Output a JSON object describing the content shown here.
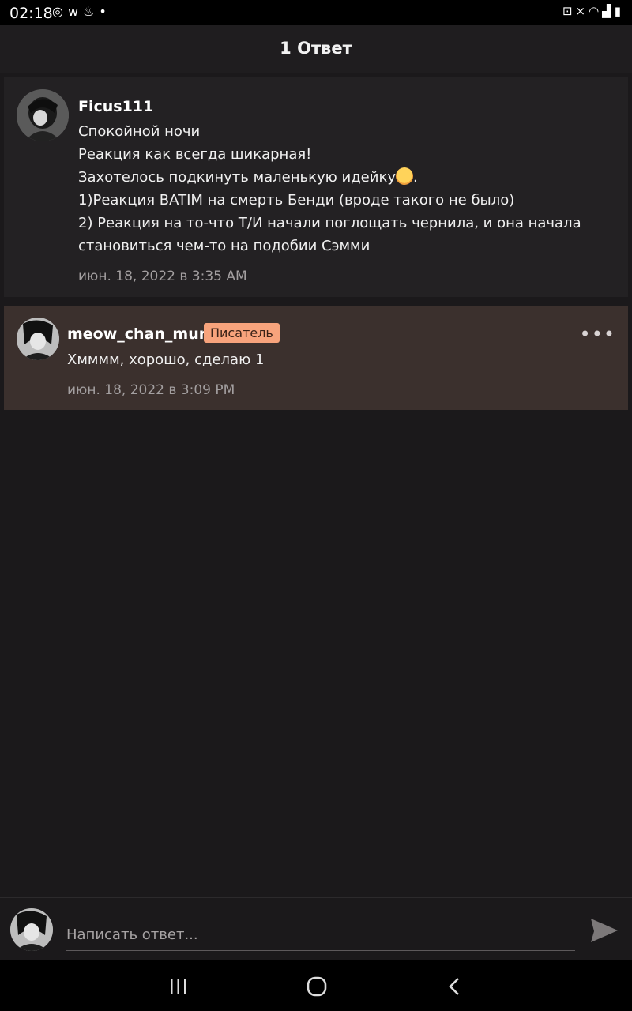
{
  "status_bar": {
    "time": "02:18",
    "left_icons": [
      "sync-icon",
      "w-app-icon",
      "flame-icon",
      "dot-icon"
    ],
    "right_icons": [
      "lock-icon",
      "mute-icon",
      "wifi-icon",
      "signal-icon",
      "battery-icon"
    ]
  },
  "header": {
    "title": "1 Ответ"
  },
  "parent_comment": {
    "username": "Ficus111",
    "lines": [
      "Спокойной ночи",
      "Реакция как всегда шикарная!",
      "Захотелось подкинуть маленькую идейку",
      "1)Реакция BATIM на смерть Бенди (вроде такого не было)",
      "2) Реакция на то-что Т/И начали поглощать чернила, и она начала",
      "становиться чем-то на подобии Сэмми"
    ],
    "line3_suffix": ".",
    "emoji": "smiling-face-with-hearts-emoji",
    "timestamp": "июн. 18, 2022 в 3:35 AM"
  },
  "reply_comment": {
    "username": "meow_chan_mur",
    "badge": "Писатель",
    "text": "Хмммм, хорошо, сделаю 1",
    "timestamp": "июн. 18, 2022 в 3:09 PM",
    "menu_icon": "more-dots-icon"
  },
  "composer": {
    "placeholder": "Написать ответ...",
    "send_icon": "send-icon"
  },
  "colors": {
    "background": "#1b191b",
    "reply_highlight": "#3b302d",
    "badge": "#f7a37c"
  }
}
